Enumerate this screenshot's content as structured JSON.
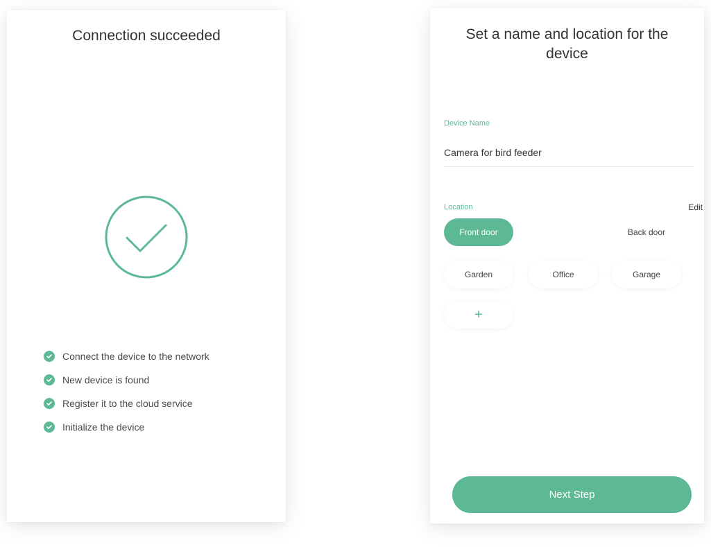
{
  "connection_screen": {
    "title": "Connection succeeded",
    "steps": [
      {
        "label": "Connect the device to the network",
        "done": true
      },
      {
        "label": "New device is found",
        "done": true
      },
      {
        "label": "Register it to the cloud service",
        "done": true
      },
      {
        "label": "Initialize the device",
        "done": true
      }
    ],
    "icon": "success-check-circle-icon"
  },
  "setup_screen": {
    "title": "Set a name and location for the device",
    "device_name": {
      "label": "Device Name",
      "value": "Camera for bird feeder"
    },
    "location": {
      "label": "Location",
      "edit_label": "Edit",
      "options": [
        {
          "label": "Front door",
          "selected": true
        },
        {
          "label": "Back door",
          "selected": false
        },
        {
          "label": "Garden",
          "selected": false
        },
        {
          "label": "Office",
          "selected": false
        },
        {
          "label": "Garage",
          "selected": false
        }
      ],
      "add_label": "+"
    },
    "next_button": "Next Step"
  },
  "colors": {
    "accent": "#5db896",
    "text": "#333333"
  }
}
